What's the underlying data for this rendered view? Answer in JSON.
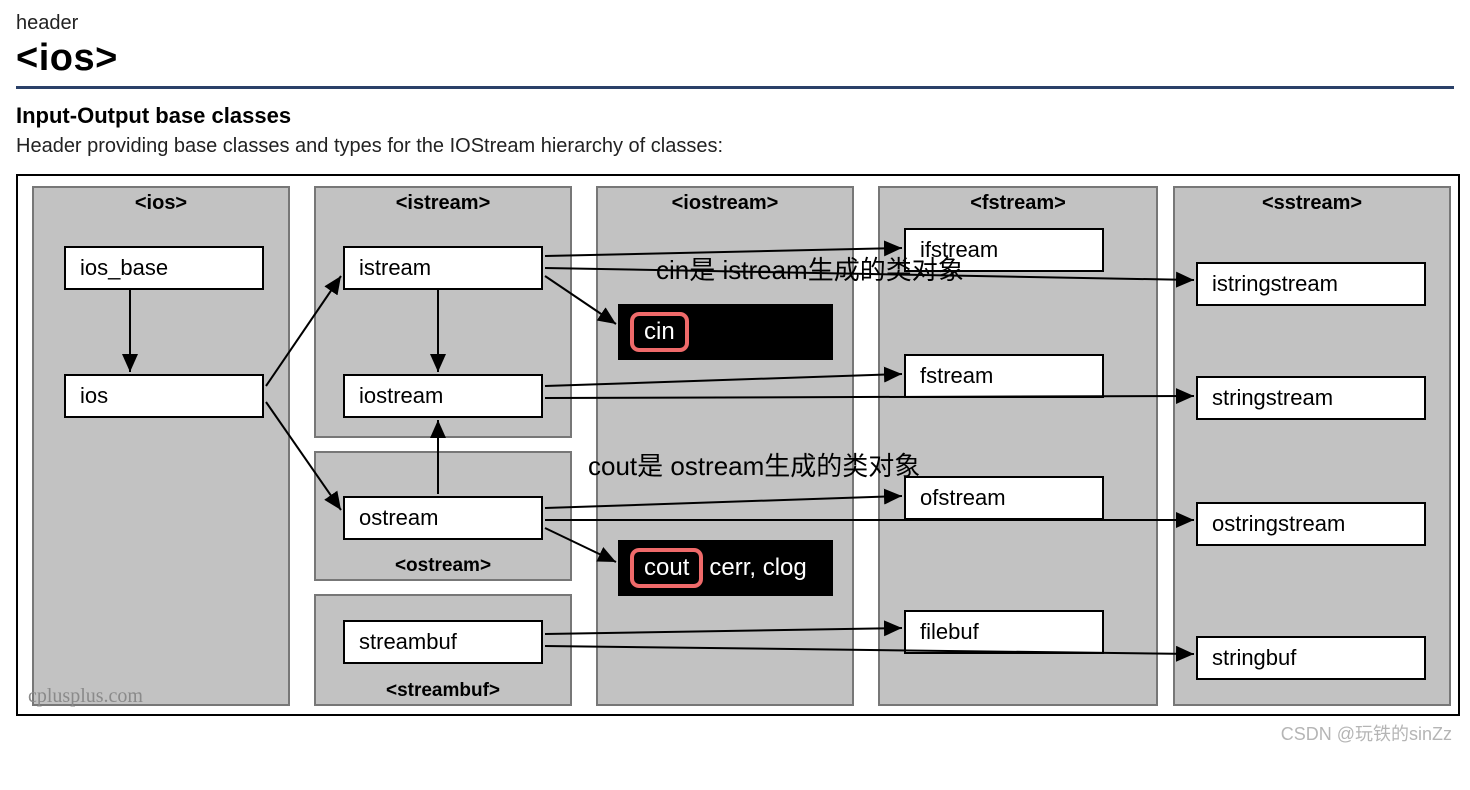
{
  "header": {
    "label": "header",
    "title": "<ios>"
  },
  "subtitle": "Input-Output base classes",
  "description": "Header providing base classes and types for the IOStream hierarchy of classes:",
  "panels": {
    "ios": {
      "title": "<ios>"
    },
    "istream": {
      "title": "<istream>"
    },
    "iostream": {
      "title": "<iostream>"
    },
    "fstream": {
      "title": "<fstream>"
    },
    "sstream": {
      "title": "<sstream>"
    },
    "ostream": {
      "footer": "<ostream>"
    },
    "streambuf": {
      "footer": "<streambuf>"
    }
  },
  "nodes": {
    "ios_base": "ios_base",
    "ios": "ios",
    "istream": "istream",
    "iostream": "iostream",
    "ostream": "ostream",
    "streambuf": "streambuf",
    "cin": "cin",
    "cout": "cout",
    "cerr_clog": "cerr, clog",
    "ifstream": "ifstream",
    "fstream": "fstream",
    "ofstream": "ofstream",
    "filebuf": "filebuf",
    "istringstream": "istringstream",
    "stringstream": "stringstream",
    "ostringstream": "ostringstream",
    "stringbuf": "stringbuf"
  },
  "annotations": {
    "cin": "cin是 istream生成的类对象",
    "cout": "cout是 ostream生成的类对象"
  },
  "watermarks": {
    "cplusplus": "cplusplus.com",
    "csdn": "CSDN @玩铁的sinZz"
  }
}
